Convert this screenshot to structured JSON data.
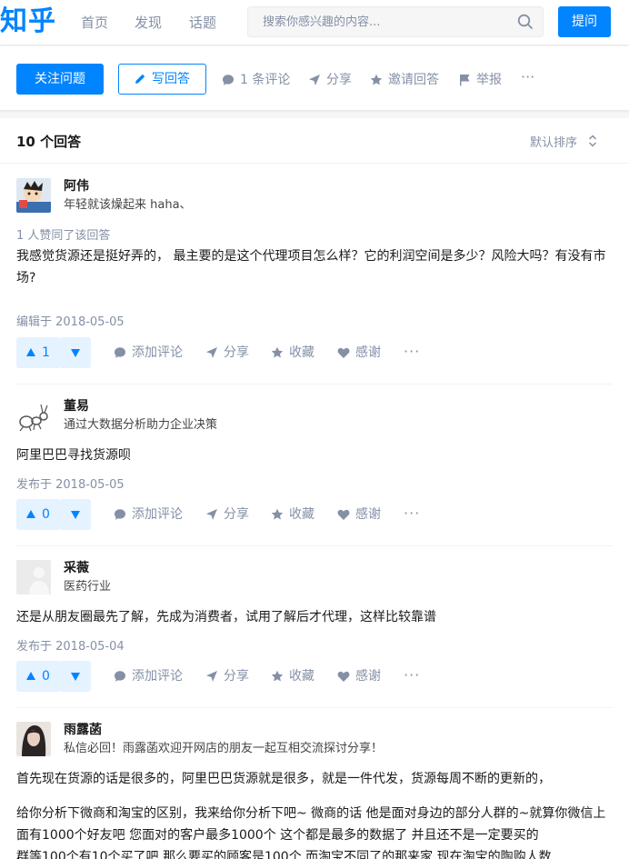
{
  "header": {
    "logo": "知乎",
    "nav": [
      "首页",
      "发现",
      "话题"
    ],
    "search_placeholder": "搜索你感兴趣的内容...",
    "ask_label": "提问"
  },
  "question_bar": {
    "follow_label": "关注问题",
    "write_label": "写回答",
    "comments_label": "1 条评论",
    "share_label": "分享",
    "invite_label": "邀请回答",
    "report_label": "举报",
    "more_label": "···"
  },
  "answers_header": {
    "count_label": "10 个回答",
    "sort_label": "默认排序"
  },
  "answer_actions": {
    "comment": "添加评论",
    "share": "分享",
    "collect": "收藏",
    "thanks": "感谢",
    "more": "···"
  },
  "answers": [
    {
      "author": "阿伟",
      "headline": "年轻就该燥起来 haha、",
      "votes_text": "1 人赞同了该回答",
      "content": "我感觉货源还是挺好弄的， 最主要的是这个代理项目怎么样？它的利润空间是多少？风险大吗？有没有市场?",
      "date": "编辑于 2018-05-05",
      "upvotes": "1"
    },
    {
      "author": "董易",
      "headline": "通过大数据分析助力企业决策",
      "content": "阿里巴巴寻找货源呗",
      "date": "发布于 2018-05-05",
      "upvotes": "0"
    },
    {
      "author": "采薇",
      "headline": "医药行业",
      "content": "还是从朋友圈最先了解，先成为消费者，试用了解后才代理，这样比较靠谱",
      "date": "发布于 2018-05-04",
      "upvotes": "0"
    },
    {
      "author": "雨露菡",
      "headline": "私信必回！雨露菡欢迎开网店的朋友一起互相交流探讨分享！",
      "content": "首先现在货源的话是很多的，阿里巴巴货源就是很多，就是一件代发，货源每周不断的更新的，",
      "content2": "给你分析下微商和淘宝的区别，我来给你分析下吧~ 微商的话 他是面对身边的部分人群的~就算你微信上面有1000个好友吧 您面对的客户最多1000个 这个都是最多的数据了 并且还不是一定要买的",
      "content3": "群等100个有10个买了吧 那么要买的顾客是100个 而淘宝不同了的那来家 现在淘宝的陶购人数"
    }
  ],
  "colors": {
    "brand": "#0084ff",
    "muted": "#8590a6",
    "vote_bg": "#e5f2ff"
  }
}
